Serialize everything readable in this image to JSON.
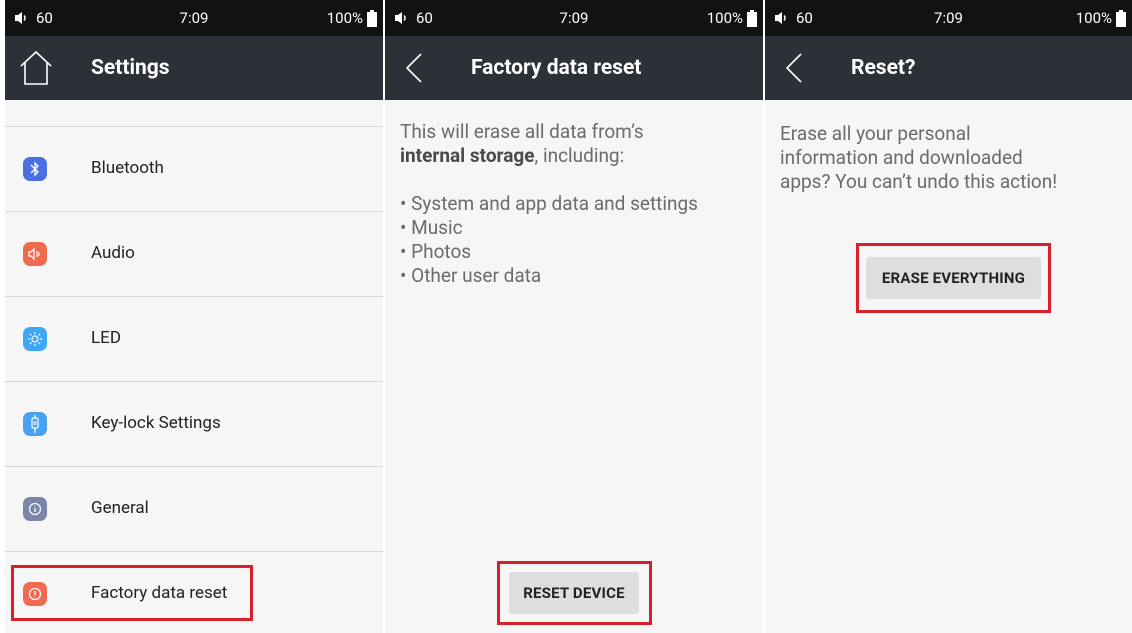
{
  "status": {
    "volume": "60",
    "time": "7:09",
    "battery": "100%"
  },
  "screen1": {
    "title": "Settings",
    "items": [
      {
        "label": "Bluetooth",
        "icon": "bluetooth-icon",
        "color": "#4a6fe3"
      },
      {
        "label": "Audio",
        "icon": "speaker-icon",
        "color": "#ef6a4f"
      },
      {
        "label": "LED",
        "icon": "sun-icon",
        "color": "#3ea8f4"
      },
      {
        "label": "Key-lock Settings",
        "icon": "key-lock-icon",
        "color": "#4aa3f0"
      },
      {
        "label": "General",
        "icon": "info-icon",
        "color": "#7a85a8"
      },
      {
        "label": "Factory data reset",
        "icon": "alert-icon",
        "color": "#ef6a4f"
      }
    ]
  },
  "screen2": {
    "title": "Factory data reset",
    "intro_prefix": "This will erase all data from’s",
    "intro_bold": "internal storage",
    "intro_suffix": ", including:",
    "bullets": [
      "• System and app data and settings",
      "• Music",
      "• Photos",
      "• Other user data"
    ],
    "button": "RESET DEVICE"
  },
  "screen3": {
    "title": "Reset?",
    "message_lines": [
      "Erase all your personal",
      "information and downloaded",
      "apps? You can’t undo this action!"
    ],
    "button": "ERASE EVERYTHING"
  },
  "colors": {
    "statusbar": "#121212",
    "appbar": "#2c3138",
    "highlight": "#d9202a",
    "background": "#f6f6f6"
  }
}
